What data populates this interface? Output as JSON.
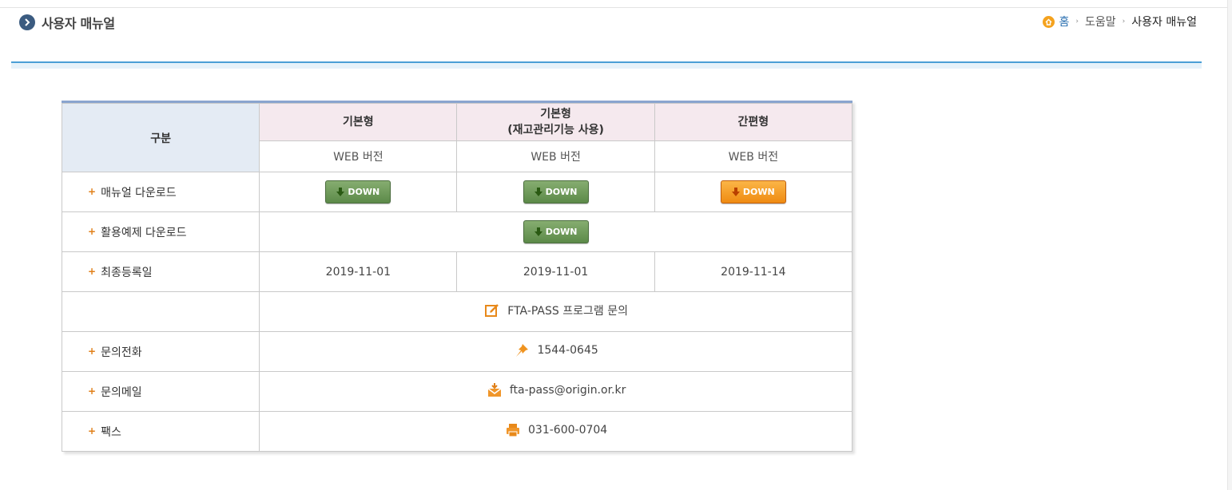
{
  "header": {
    "title": "사용자 매뉴얼"
  },
  "breadcrumb": {
    "home": "홈",
    "level2": "도움말",
    "current": "사용자 매뉴얼"
  },
  "colors": {
    "accent_blue": "#4a9fd6",
    "button_green": "#6c9a57",
    "button_orange": "#f39a1f",
    "plus_orange": "#e07f18"
  },
  "table": {
    "gubun_label": "구분",
    "types": [
      {
        "line1": "기본형",
        "line2": ""
      },
      {
        "line1": "기본형",
        "line2": "(재고관리기능 사용)"
      },
      {
        "line1": "간편형",
        "line2": ""
      }
    ],
    "version_labels": [
      "WEB 버전",
      "WEB 버전",
      "WEB 버전"
    ],
    "rows": {
      "manual_download": {
        "label": "매뉴얼 다운로드",
        "buttons": [
          "DOWN",
          "DOWN",
          "DOWN"
        ]
      },
      "example_download": {
        "label": "활용예제 다운로드",
        "button": "DOWN"
      },
      "last_registered": {
        "label": "최종등록일",
        "dates": [
          "2019-11-01",
          "2019-11-01",
          "2019-11-14"
        ]
      },
      "inquiry": {
        "label": "",
        "text": "FTA-PASS 프로그램 문의"
      },
      "phone": {
        "label": "문의전화",
        "value": "1544-0645"
      },
      "email": {
        "label": "문의메일",
        "value": "fta-pass@origin.or.kr"
      },
      "fax": {
        "label": "팩스",
        "value": "031-600-0704"
      }
    }
  },
  "icons": {
    "title": "chevron-right-circle-icon",
    "home": "home-icon",
    "separator": "chevron-right-icon",
    "download": "download-arrow-icon",
    "inquiry": "edit-note-icon",
    "phone": "pin-icon",
    "email": "mail-icon",
    "fax": "printer-icon"
  }
}
